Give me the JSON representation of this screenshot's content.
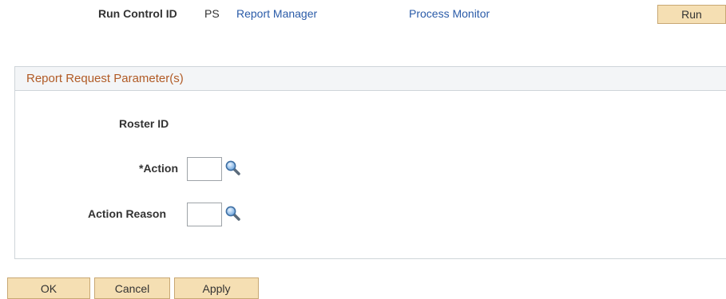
{
  "header": {
    "run_control_label": "Run Control ID",
    "run_control_value": "PS",
    "report_manager_link": "Report Manager",
    "process_monitor_link": "Process Monitor",
    "run_button": "Run"
  },
  "report_request": {
    "title": "Report Request Parameter(s)",
    "roster_id_label": "Roster ID",
    "action_label": "*Action",
    "action_value": "",
    "action_reason_label": "Action Reason",
    "action_reason_value": ""
  },
  "footer": {
    "ok_button": "OK",
    "cancel_button": "Cancel",
    "apply_button": "Apply"
  },
  "icons": {
    "lookup": "magnifying-glass-icon"
  },
  "colors": {
    "button_bg": "#f5dfb3",
    "link": "#2a5ba8",
    "group_title": "#b15b26"
  }
}
